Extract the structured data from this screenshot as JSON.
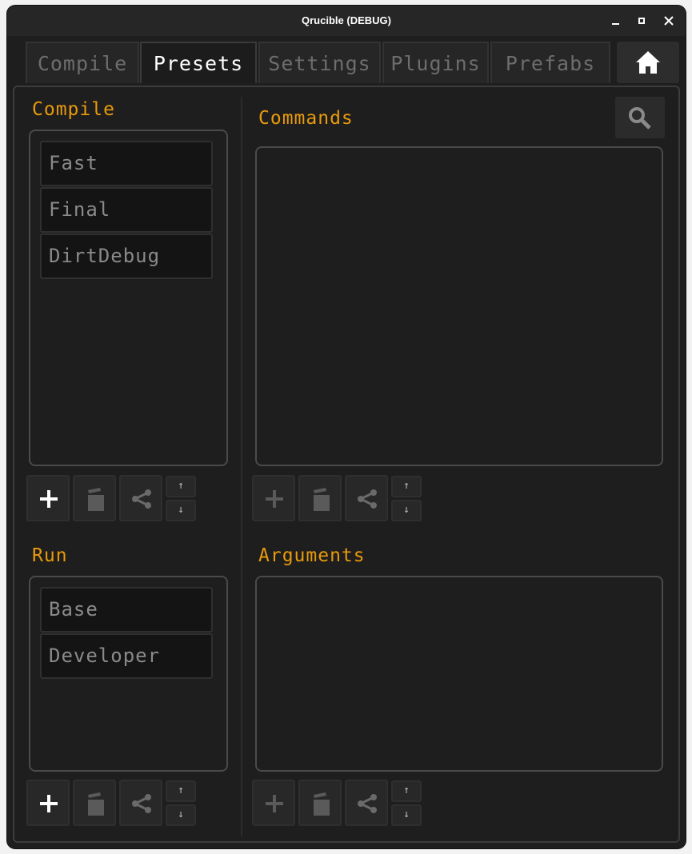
{
  "window": {
    "title": "Qrucible (DEBUG)"
  },
  "tabs": [
    {
      "label": "Compile",
      "active": false
    },
    {
      "label": "Presets",
      "active": true
    },
    {
      "label": "Settings",
      "active": false
    },
    {
      "label": "Plugins",
      "active": false
    },
    {
      "label": "Prefabs",
      "active": false
    }
  ],
  "compile": {
    "title": "Compile",
    "items": [
      "Fast",
      "Final",
      "DirtDebug"
    ]
  },
  "commands": {
    "title": "Commands",
    "items": []
  },
  "run": {
    "title": "Run",
    "items": [
      "Base",
      "Developer"
    ]
  },
  "arguments": {
    "title": "Arguments",
    "items": []
  },
  "icons": {
    "home": "home-icon",
    "search": "search-icon",
    "add": "plus-icon",
    "delete": "trash-icon",
    "share": "share-icon",
    "up": "arrow-up-icon",
    "down": "arrow-down-icon"
  },
  "colors": {
    "accent": "#e89a0c",
    "background": "#1e1e1e",
    "active_tab_text": "#ffffff",
    "inactive_tab_text": "#6d6d6d"
  }
}
